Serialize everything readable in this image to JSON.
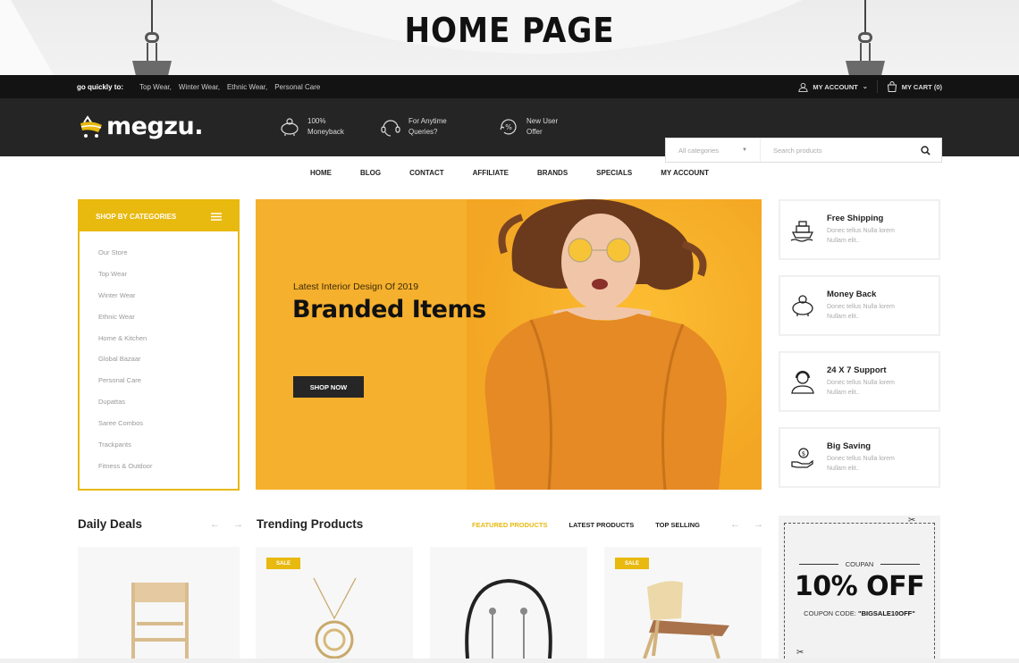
{
  "banner": {
    "title": "HOME PAGE"
  },
  "topbar": {
    "label": "go quickly to:",
    "links": [
      "Top Wear,",
      "Winter Wear,",
      "Ethnic Wear,",
      "Personal Care"
    ],
    "account": "MY ACCOUNT",
    "cart": "MY CART (0)"
  },
  "header": {
    "logo": "megzu.",
    "features": [
      {
        "icon": "piggy-bank-icon",
        "line1": "100%",
        "line2": "Moneyback"
      },
      {
        "icon": "headset-icon",
        "line1": "For Anytime",
        "line2": "Queries?"
      },
      {
        "icon": "percent-offer-icon",
        "line1": "New User",
        "line2": "Offer"
      }
    ],
    "search": {
      "category": "All categories",
      "placeholder": "Search products"
    }
  },
  "nav": [
    "HOME",
    "BLOG",
    "CONTACT",
    "AFFILIATE",
    "BRANDS",
    "SPECIALS",
    "MY ACCOUNT"
  ],
  "categories": {
    "title": "SHOP BY CATEGORIES",
    "items": [
      "Our Store",
      "Top Wear",
      "Winter Wear",
      "Ethnic Wear",
      "Home & Kitchen",
      "Global Bazaar",
      "Personal Care",
      "Dupattas",
      "Saree Combos",
      "Trackpants",
      "Fitness & Outdoor"
    ]
  },
  "hero": {
    "subtitle": "Latest Interior Design Of 2019",
    "title": "Branded Items",
    "button": "SHOP NOW",
    "accent": "#f5b02e"
  },
  "services": [
    {
      "icon": "ship-icon",
      "title": "Free Shipping",
      "desc1": "Donec tellus Nulla lorem",
      "desc2": "Nullam elit.."
    },
    {
      "icon": "piggy-bank-icon",
      "title": "Money Back",
      "desc1": "Donec tellus Nulla lorem",
      "desc2": "Nullam elit.."
    },
    {
      "icon": "support-agent-icon",
      "title": "24 X 7 Support",
      "desc1": "Donec tellus Nulla lorem",
      "desc2": "Nullam elit.."
    },
    {
      "icon": "coin-hand-icon",
      "title": "Big Saving",
      "desc1": "Donec tellus Nulla lorem",
      "desc2": "Nullam elit.."
    }
  ],
  "daily_deals": {
    "title": "Daily Deals",
    "arrows": "← →"
  },
  "trending": {
    "title": "Trending Products",
    "tabs": [
      "FEATURED PRODUCTS",
      "LATEST PRODUCTS",
      "TOP SELLING"
    ],
    "active_tab": 0,
    "arrows": "← →",
    "sale_badge": "SALE"
  },
  "products": [
    {
      "name": "Wooden chair",
      "sale": false
    },
    {
      "name": "Gold pendant necklace",
      "sale": true
    },
    {
      "name": "Neckband earphones",
      "sale": false
    },
    {
      "name": "Wooden chair",
      "sale": true
    }
  ],
  "coupon": {
    "label": "COUPAN",
    "headline": "10% OFF",
    "code_label": "COUPON CODE:",
    "code": "\"BIGSALE10OFF\""
  },
  "colors": {
    "brand": "#e8b90f",
    "dark": "#252525",
    "topbar": "#131313"
  }
}
